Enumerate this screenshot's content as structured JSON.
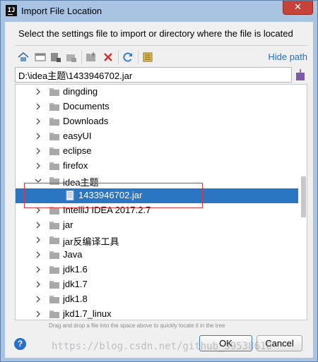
{
  "window": {
    "title": "Import File Location",
    "close_symbol": "✕"
  },
  "description": "Select the settings file to import or directory where the file is located",
  "toolbar": {
    "buttons": [
      "home-icon",
      "desktop-icon",
      "project-icon",
      "module-icon",
      "new-folder-icon",
      "delete-icon",
      "refresh-icon",
      "show-hidden-icon"
    ],
    "hide_path_label": "Hide path"
  },
  "path": {
    "value": "D:\\idea主题\\1433946702.jar"
  },
  "tree": {
    "items": [
      {
        "label": "dingding",
        "level": 1,
        "arrow": "right",
        "type": "folder"
      },
      {
        "label": "Documents",
        "level": 1,
        "arrow": "right",
        "type": "folder"
      },
      {
        "label": "Downloads",
        "level": 1,
        "arrow": "right",
        "type": "folder"
      },
      {
        "label": "easyUI",
        "level": 1,
        "arrow": "right",
        "type": "folder"
      },
      {
        "label": "eclipse",
        "level": 1,
        "arrow": "right",
        "type": "folder"
      },
      {
        "label": "firefox",
        "level": 1,
        "arrow": "right",
        "type": "folder"
      },
      {
        "label": "idea主题",
        "level": 1,
        "arrow": "down",
        "type": "folder"
      },
      {
        "label": "1433946702.jar",
        "level": 2,
        "arrow": "none",
        "type": "jar",
        "selected": true
      },
      {
        "label": "IntelliJ IDEA 2017.2.7",
        "level": 1,
        "arrow": "right",
        "type": "folder"
      },
      {
        "label": "jar",
        "level": 1,
        "arrow": "right",
        "type": "folder"
      },
      {
        "label": "jar反编译工具",
        "level": 1,
        "arrow": "right",
        "type": "folder"
      },
      {
        "label": "Java",
        "level": 1,
        "arrow": "right",
        "type": "folder"
      },
      {
        "label": "jdk1.6",
        "level": 1,
        "arrow": "right",
        "type": "folder"
      },
      {
        "label": "jdk1.7",
        "level": 1,
        "arrow": "right",
        "type": "folder"
      },
      {
        "label": "jdk1.8",
        "level": 1,
        "arrow": "right",
        "type": "folder"
      },
      {
        "label": "jkd1.7_linux",
        "level": 1,
        "arrow": "right",
        "type": "folder"
      }
    ]
  },
  "hint": "Drag and drop a file into the space above to quickly locate it in the tree",
  "buttons": {
    "help": "?",
    "ok": "OK",
    "cancel": "Cancel"
  },
  "watermark": "https://blog.csdn.net/github_39538610",
  "colors": {
    "selection": "#2b76c2",
    "link": "#1f6fc5",
    "highlight_box": "#e0373a"
  }
}
